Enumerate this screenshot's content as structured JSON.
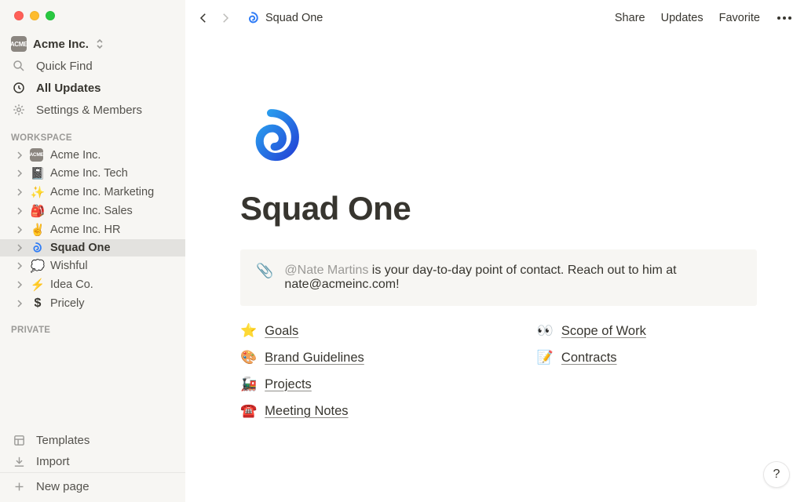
{
  "workspace": {
    "name": "Acme Inc.",
    "badge": "ACME"
  },
  "sidebar_top": {
    "quick_find": "Quick Find",
    "all_updates": "All Updates",
    "settings_members": "Settings & Members"
  },
  "sections": {
    "workspace_label": "WORKSPACE",
    "private_label": "PRIVATE"
  },
  "workspace_pages": [
    {
      "emoji": "badge",
      "label": "Acme Inc."
    },
    {
      "emoji": "📓",
      "label": "Acme Inc. Tech"
    },
    {
      "emoji": "✨",
      "label": "Acme Inc. Marketing"
    },
    {
      "emoji": "🎒",
      "label": "Acme Inc. Sales"
    },
    {
      "emoji": "✌️",
      "label": "Acme Inc. HR"
    },
    {
      "emoji": "spiral",
      "label": "Squad One",
      "selected": true
    },
    {
      "emoji": "💭",
      "label": "Wishful"
    },
    {
      "emoji": "⚡",
      "label": "Idea Co."
    },
    {
      "emoji": "💲",
      "label": "Pricely"
    }
  ],
  "sidebar_bottom": {
    "templates": "Templates",
    "import": "Import",
    "new_page": "New page"
  },
  "topbar": {
    "breadcrumb": "Squad One",
    "share": "Share",
    "updates": "Updates",
    "favorite": "Favorite"
  },
  "page": {
    "title": "Squad One",
    "callout_mention": "@Nate Martins",
    "callout_text_1": " is your day-to-day point of contact. Reach out to him at ",
    "callout_email": "nate@acmeinc.com",
    "callout_suffix": "!"
  },
  "links_left": [
    {
      "emoji": "⭐",
      "label": "Goals"
    },
    {
      "emoji": "🎨",
      "label": "Brand Guidelines"
    },
    {
      "emoji": "🚂",
      "label": "Projects"
    },
    {
      "emoji": "☎️",
      "label": "Meeting Notes"
    }
  ],
  "links_right": [
    {
      "emoji": "👀",
      "label": "Scope of Work"
    },
    {
      "emoji": "📝",
      "label": "Contracts"
    }
  ],
  "help_label": "?"
}
